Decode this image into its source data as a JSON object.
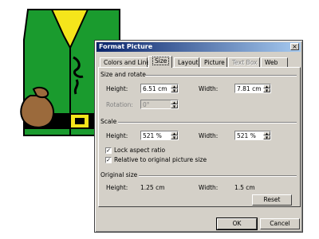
{
  "dialog": {
    "title": "Format Picture",
    "close_glyph": "×",
    "tabs": [
      {
        "label": "Colors and Lines"
      },
      {
        "label": "Size"
      },
      {
        "label": "Layout"
      },
      {
        "label": "Picture"
      },
      {
        "label": "Text Box"
      },
      {
        "label": "Web"
      }
    ],
    "active_tab": "Size",
    "size_rotate": {
      "heading": "Size and rotate",
      "height_label": "Height:",
      "height_value": "6.51 cm",
      "width_label": "Width:",
      "width_value": "7.81 cm",
      "rotation_label": "Rotation:",
      "rotation_value": "0°"
    },
    "scale": {
      "heading": "Scale",
      "height_label": "Height:",
      "height_value": "521 %",
      "width_label": "Width:",
      "width_value": "521 %",
      "lock_aspect_label": "Lock aspect ratio",
      "lock_aspect_checked": true,
      "relative_label": "Relative to original picture size",
      "relative_checked": true
    },
    "original_size": {
      "heading": "Original size",
      "height_label": "Height:",
      "height_value": "1.25 cm",
      "width_label": "Width:",
      "width_value": "1.5 cm"
    },
    "reset_label": "Reset",
    "ok_label": "OK",
    "cancel_label": "Cancel",
    "check_glyph": "✓",
    "spin_up_glyph": "▲",
    "spin_down_glyph": "▼"
  },
  "colors": {
    "shirt_green": "#1a9b2e",
    "vest_yellow": "#f5e51b",
    "bag_brown": "#9b6a3c",
    "title_blue": "#0a246a",
    "dialog_grey": "#d4d0c8"
  }
}
